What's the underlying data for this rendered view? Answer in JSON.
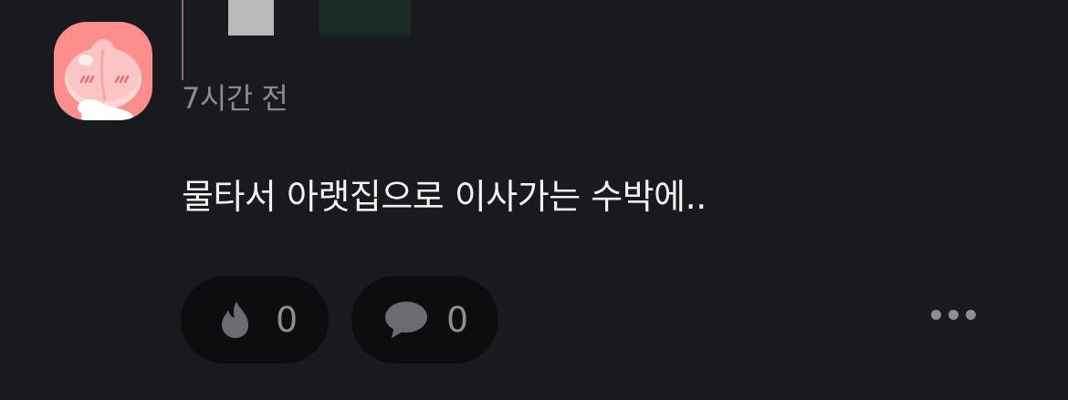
{
  "comment": {
    "timestamp": "7시간 전",
    "text": "물타서 아랫집으로 이사가는 수박에..",
    "like_count": "0",
    "reply_count": "0"
  },
  "icons": {
    "like": "flame-icon",
    "reply": "speech-bubble-icon",
    "more": "more-dots-icon",
    "avatar": "peach-character-avatar"
  },
  "colors": {
    "background": "#181a1d",
    "avatar_bg": "#fc8f8c",
    "pill_bg": "#0c0d0f",
    "muted_text": "#8c8c90",
    "text": "#f2f2f2"
  }
}
